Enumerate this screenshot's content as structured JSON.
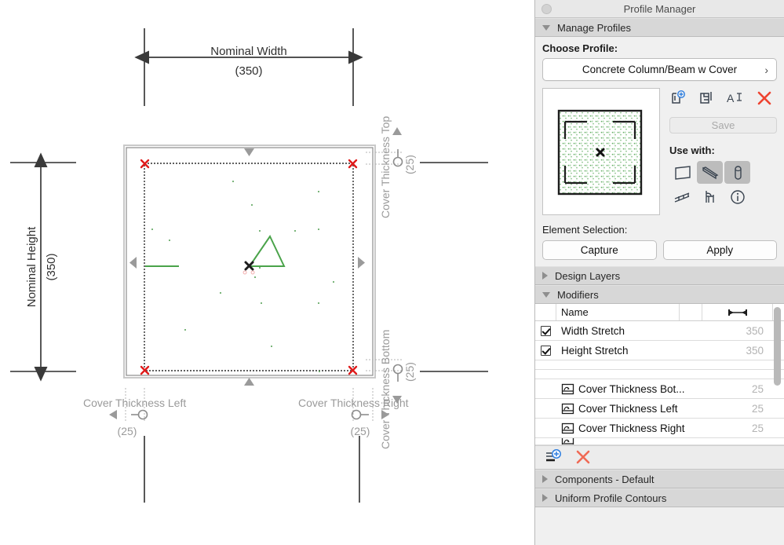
{
  "window": {
    "title": "Profile Manager",
    "close_button": "close-button"
  },
  "sections": {
    "manage_profiles": "Manage Profiles",
    "design_layers": "Design Layers",
    "modifiers": "Modifiers",
    "components_default": "Components - Default",
    "uniform_profile_contours": "Uniform Profile Contours"
  },
  "choose_profile": {
    "label": "Choose Profile:",
    "selected": "Concrete Column/Beam w Cover",
    "chevron": "chevron-right-icon"
  },
  "profile_tools": {
    "new_profile": "new-profile-icon",
    "duplicate_profile": "duplicate-profile-icon",
    "rename_profile": "rename-profile-icon",
    "delete_profile": "delete-profile-icon",
    "save_label": "Save"
  },
  "use_with": {
    "label": "Use with:",
    "items": [
      {
        "name": "wall-icon",
        "selected": false
      },
      {
        "name": "beam-icon",
        "selected": true
      },
      {
        "name": "column-icon",
        "selected": true
      },
      {
        "name": "railing-icon",
        "selected": false
      },
      {
        "name": "furniture-icon",
        "selected": false
      },
      {
        "name": "info-icon",
        "selected": false
      }
    ]
  },
  "element_selection": {
    "label": "Element Selection:",
    "capture": "Capture",
    "apply": "Apply"
  },
  "modifiers_table": {
    "columns": {
      "name": "Name",
      "value_icon": "width-measure-icon"
    },
    "rows": [
      {
        "type": "checkbox",
        "checked": true,
        "name": "Width Stretch",
        "value": "350"
      },
      {
        "type": "checkbox",
        "checked": true,
        "name": "Height Stretch",
        "value": "350"
      },
      {
        "type": "blank",
        "name": "",
        "value": ""
      },
      {
        "type": "blank",
        "name": "",
        "value": ""
      },
      {
        "type": "icon",
        "icon": "modifier-icon",
        "name": "Cover Thickness Bot...",
        "value": "25"
      },
      {
        "type": "icon",
        "icon": "modifier-icon",
        "name": "Cover Thickness Left",
        "value": "25"
      },
      {
        "type": "icon",
        "icon": "modifier-icon",
        "name": "Cover Thickness Right",
        "value": "25"
      }
    ]
  },
  "modifier_tools": {
    "add_modifier": "add-modifier-icon",
    "delete_modifier": "delete-modifier-icon"
  },
  "drawing": {
    "nominal_width_label": "Nominal Width",
    "nominal_width_value": "(350)",
    "nominal_height_label": "Nominal Height",
    "nominal_height_value": "(350)",
    "cover_top_label": "Cover Thickness Top",
    "cover_top_value": "(25)",
    "cover_bottom_label": "Cover Thickness Bottom",
    "cover_bottom_value": "(25)",
    "cover_left_label": "Cover Thickness Left",
    "cover_left_value": "(25)",
    "cover_right_label": "Cover Thickness Right",
    "cover_right_value": "(25)"
  },
  "colors": {
    "accent_blue": "#2f7fe0",
    "delete_red": "#ee4330",
    "vertex_red": "#e01b1b",
    "geometry_green": "#4aa34a",
    "dim_gray": "#9a9a9a",
    "panel_bg": "#f0f0f0",
    "header_bg": "#d7d7d7"
  }
}
